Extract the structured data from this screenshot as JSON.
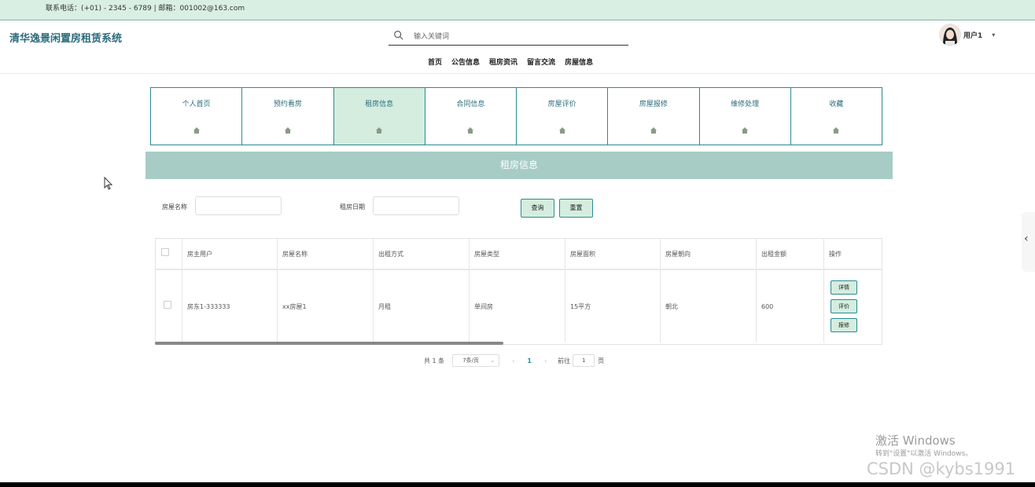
{
  "contact": "联系电话：(+01) - 2345 - 6789 | 邮箱：001002@163.com",
  "brand": "清华逸景闲置房租赁系统",
  "search": {
    "placeholder": "输入关键词"
  },
  "nav": [
    "首页",
    "公告信息",
    "租房资讯",
    "留言交流",
    "房屋信息"
  ],
  "user": {
    "name": "用户1"
  },
  "menu": [
    {
      "label": "个人首页"
    },
    {
      "label": "预约看房"
    },
    {
      "label": "租房信息",
      "active": true
    },
    {
      "label": "合同信息"
    },
    {
      "label": "房屋评价"
    },
    {
      "label": "房屋报修"
    },
    {
      "label": "维修处理"
    },
    {
      "label": "收藏"
    }
  ],
  "panel_title": "租房信息",
  "filters": {
    "house_name_label": "房屋名称",
    "date_label": "租房日期",
    "query_button": "查询",
    "reset_button": "重置"
  },
  "table": {
    "headers": [
      "房主用户",
      "房屋名称",
      "出租方式",
      "房屋类型",
      "房屋面积",
      "房屋朝向",
      "出租金额",
      "操作"
    ],
    "rows": [
      [
        "房东1-333333",
        "xx房屋1",
        "月租",
        "单间房",
        "15平方",
        "朝北",
        "600"
      ]
    ],
    "actions": [
      "详情",
      "评价",
      "报修"
    ]
  },
  "pagination": {
    "total": "共 1 条",
    "page_size": "7条/页",
    "prev": "‹",
    "current": "1",
    "next": "›",
    "goto": "前往",
    "goto_value": "1",
    "unit": "页"
  },
  "watermark": {
    "activate_title": "激活 Windows",
    "activate_sub": "转到\"设置\"以激活 Windows。",
    "csdn": "CSDN @kybs1991"
  },
  "colors": {
    "accent": "#2b8a93",
    "active_bg": "#d4eddf",
    "panel_bg": "#a7ccc5",
    "topbar_bg": "#d9efe3"
  }
}
